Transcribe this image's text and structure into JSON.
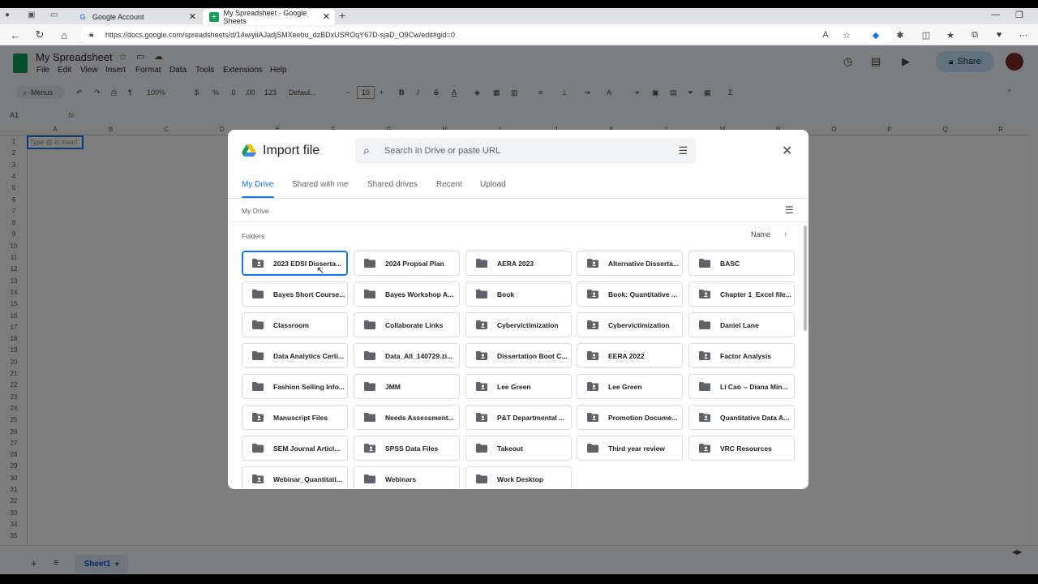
{
  "browser": {
    "tabs": [
      {
        "title": "Google Account"
      },
      {
        "title": "My Spreadsheet - Google Sheets"
      }
    ],
    "url": "https://docs.google.com/spreadsheets/d/14wiyiiAJadjSMXeebu_dzBDxUSROqY67D-sjaD_O9Cw/edit#gid=0"
  },
  "sheets": {
    "doc_title": "My Spreadsheet",
    "menus": [
      "File",
      "Edit",
      "View",
      "Insert",
      "Format",
      "Data",
      "Tools",
      "Extensions",
      "Help"
    ],
    "share_label": "Share",
    "toolbar": {
      "menus_label": "Menus",
      "zoom": "100%",
      "currency": "$",
      "percent": "%",
      "dec_less": ".0",
      "dec_more": ".00",
      "number_format": "123",
      "font": "Defaul...",
      "font_size": "10",
      "sum": "Σ"
    },
    "name_box": "A1",
    "fx": "fx",
    "cell_hint": "Type @ to insert",
    "columns": [
      "A",
      "B",
      "C",
      "D",
      "E",
      "F",
      "G",
      "H",
      "I",
      "J",
      "K",
      "L",
      "M",
      "N",
      "O",
      "P",
      "Q",
      "R"
    ],
    "rows": [
      "1",
      "2",
      "3",
      "4",
      "5",
      "6",
      "7",
      "8",
      "9",
      "10",
      "11",
      "12",
      "13",
      "14",
      "15",
      "16",
      "17",
      "18",
      "19",
      "20",
      "21",
      "22",
      "23",
      "24",
      "25",
      "26",
      "27",
      "28",
      "29",
      "30",
      "31",
      "32",
      "33",
      "34",
      "35"
    ],
    "sheet_tab": "Sheet1"
  },
  "dialog": {
    "title": "Import file",
    "search_placeholder": "Search in Drive or paste URL",
    "tabs": [
      "My Drive",
      "Shared with me",
      "Shared drives",
      "Recent",
      "Upload"
    ],
    "breadcrumb": "My Drive",
    "folders_heading": "Folders",
    "sort_label": "Name",
    "folders": [
      {
        "name": "2023 EDSI Disserta...",
        "shared": true
      },
      {
        "name": "2024 Propsal Plan",
        "shared": false
      },
      {
        "name": "AERA 2023",
        "shared": false
      },
      {
        "name": "Alternative Disserta...",
        "shared": true
      },
      {
        "name": "BASC",
        "shared": false
      },
      {
        "name": "Bayes Short Course...",
        "shared": false
      },
      {
        "name": "Bayes Workshop A...",
        "shared": false
      },
      {
        "name": "Book",
        "shared": false
      },
      {
        "name": "Book: Quantitative ...",
        "shared": true
      },
      {
        "name": "Chapter 1_Excel file...",
        "shared": true
      },
      {
        "name": "Classroom",
        "shared": false
      },
      {
        "name": "Collaborate Links",
        "shared": false
      },
      {
        "name": "Cybervictimization",
        "shared": true
      },
      {
        "name": "Cybervictimization",
        "shared": true
      },
      {
        "name": "Daniel Lane",
        "shared": false
      },
      {
        "name": "Data Analytics Certi...",
        "shared": false
      },
      {
        "name": "Data_All_140729.zi...",
        "shared": false
      },
      {
        "name": "Dissertation Boot C...",
        "shared": true
      },
      {
        "name": "EERA 2022",
        "shared": true
      },
      {
        "name": "Factor Analysis",
        "shared": true
      },
      {
        "name": "Fashion Selling Info...",
        "shared": false
      },
      {
        "name": "JMM",
        "shared": false
      },
      {
        "name": "Lee Green",
        "shared": true
      },
      {
        "name": "Lee Green",
        "shared": true
      },
      {
        "name": "Li Cao -- Diana Min...",
        "shared": false
      },
      {
        "name": "Manuscript Files",
        "shared": true
      },
      {
        "name": "Needs Assessment...",
        "shared": false
      },
      {
        "name": "P&T Departmental ...",
        "shared": true
      },
      {
        "name": "Promotion Docume...",
        "shared": true
      },
      {
        "name": "Quantitative Data A...",
        "shared": true
      },
      {
        "name": "SEM Journal Articl...",
        "shared": false
      },
      {
        "name": "SPSS Data Files",
        "shared": true
      },
      {
        "name": "Takeout",
        "shared": false
      },
      {
        "name": "Third year review",
        "shared": false
      },
      {
        "name": "VRC Resources",
        "shared": true
      },
      {
        "name": "Webinar_Quantitati...",
        "shared": true
      },
      {
        "name": "Webinars",
        "shared": false
      },
      {
        "name": "Work Desktop",
        "shared": false
      }
    ]
  },
  "colors": {
    "accent": "#1a73e8",
    "sheets_green": "#0f9d58",
    "share_bg": "#c2e7ff"
  }
}
